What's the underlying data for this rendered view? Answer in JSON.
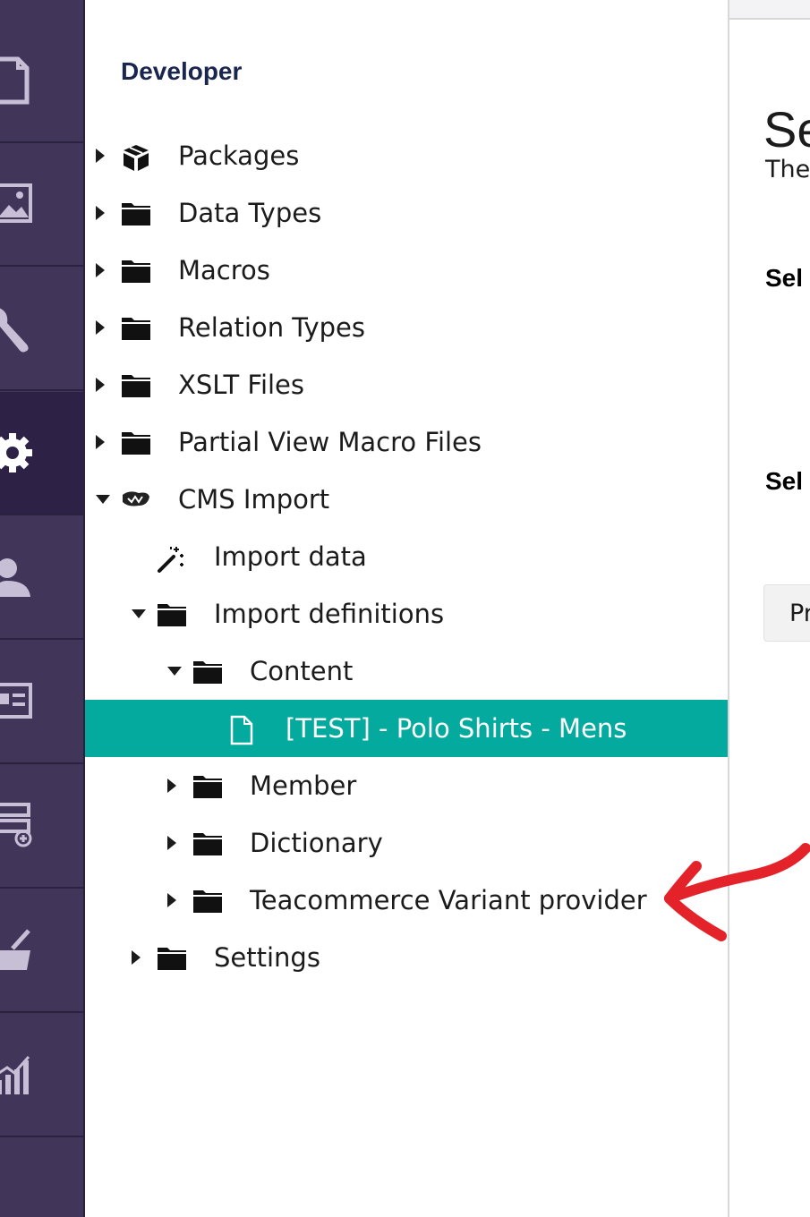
{
  "app_nav": {
    "items": [
      {
        "name": "content-section",
        "icon": "document-icon"
      },
      {
        "name": "media-section",
        "icon": "image-icon"
      },
      {
        "name": "settings-section",
        "icon": "wrench-icon"
      },
      {
        "name": "developer-section",
        "icon": "gear-icon",
        "active": true
      },
      {
        "name": "users-section",
        "icon": "user-icon"
      },
      {
        "name": "members-section",
        "icon": "id-card-icon"
      },
      {
        "name": "forms-section",
        "icon": "form-add-icon"
      },
      {
        "name": "commerce-section",
        "icon": "basket-icon"
      },
      {
        "name": "analytics-section",
        "icon": "chart-icon"
      }
    ]
  },
  "tree": {
    "title": "Developer",
    "nodes": [
      {
        "label": "Packages",
        "icon": "package-icon",
        "caret": "right"
      },
      {
        "label": "Data Types",
        "icon": "folder-icon",
        "caret": "right"
      },
      {
        "label": "Macros",
        "icon": "folder-icon",
        "caret": "right"
      },
      {
        "label": "Relation Types",
        "icon": "folder-icon",
        "caret": "right"
      },
      {
        "label": "XSLT Files",
        "icon": "folder-icon",
        "caret": "right"
      },
      {
        "label": "Partial View Macro Files",
        "icon": "folder-icon",
        "caret": "right"
      },
      {
        "label": "CMS Import",
        "icon": "cms-import-logo-icon",
        "caret": "down"
      },
      {
        "label": "Import data",
        "icon": "magic-wand-icon",
        "caret": "none"
      },
      {
        "label": "Import definitions",
        "icon": "folder-icon",
        "caret": "down"
      },
      {
        "label": "Content",
        "icon": "folder-icon",
        "caret": "down"
      },
      {
        "label": "[TEST] - Polo Shirts - Mens",
        "icon": "document-outline-icon",
        "caret": "none",
        "selected": true
      },
      {
        "label": "Member",
        "icon": "folder-icon",
        "caret": "right"
      },
      {
        "label": "Dictionary",
        "icon": "folder-icon",
        "caret": "right"
      },
      {
        "label": "Teacommerce Variant provider",
        "icon": "folder-icon",
        "caret": "right"
      },
      {
        "label": "Settings",
        "icon": "folder-icon",
        "caret": "right"
      }
    ]
  },
  "content": {
    "heading": "Se",
    "subtext": "The",
    "label_1": "Sel",
    "label_2": "Sel",
    "button_label": "Pr"
  },
  "colors": {
    "nav_bg": "#413659",
    "nav_active": "#2d2245",
    "selected_bg": "#03aa9d",
    "annotation_arrow": "#e4222a"
  }
}
